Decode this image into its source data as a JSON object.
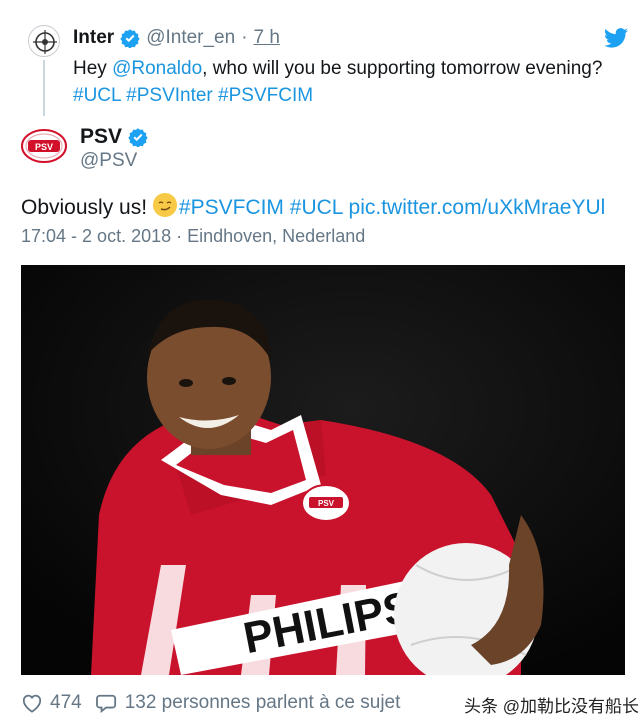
{
  "quoted_tweet": {
    "name": "Inter",
    "handle": "@Inter_en",
    "separator": "·",
    "time": "7 h",
    "text_prefix": "Hey ",
    "mention": "@Ronaldo",
    "text_suffix": ", who will you be supporting tomorrow evening?",
    "hashtags": [
      "#UCL",
      "#PSVInter",
      "#PSVFCIM"
    ]
  },
  "tweet": {
    "name": "PSV",
    "handle": "@PSV",
    "text_prefix": "Obviously us!",
    "hashtags": [
      "#PSVFCIM",
      "#UCL"
    ],
    "link": "pic.twitter.com/uXkMraeYUl",
    "timestamp": "17:04 - 2 oct. 2018 · Eindhoven, Nederland",
    "photo_jersey_text": "PHILIPS",
    "photo_badge_text": "PSV",
    "avatar_text": "PSV"
  },
  "actions": {
    "likes": "474",
    "replies_text": "132 personnes parlent à ce sujet"
  },
  "watermark": "头条 @加勒比没有船长",
  "colors": {
    "link": "#1b95e0",
    "verified": "#1da1f2",
    "psv_red": "#d3102a"
  },
  "icons": [
    "verified-badge-icon",
    "twitter-bird-icon",
    "heart-icon",
    "reply-bubble-icon"
  ]
}
